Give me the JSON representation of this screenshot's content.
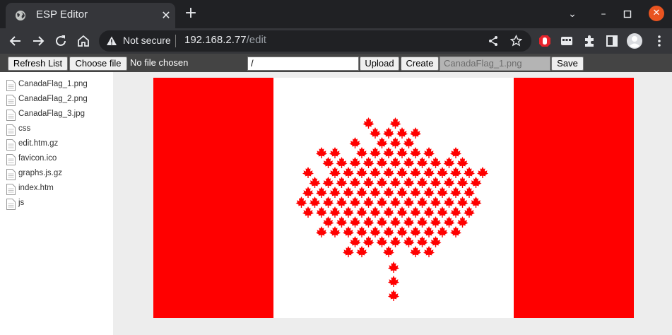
{
  "browser": {
    "tab_title": "ESP Editor",
    "security_label": "Not secure",
    "url_host": "192.168.2.77",
    "url_path": "/edit"
  },
  "editor": {
    "refresh_label": "Refresh List",
    "choose_file_label": "Choose file",
    "no_file_label": "No file chosen",
    "path_value": "/",
    "upload_label": "Upload",
    "create_label": "Create",
    "open_file_value": "CanadaFlag_1.png",
    "save_label": "Save"
  },
  "files": [
    "CanadaFlag_1.png",
    "CanadaFlag_2.png",
    "CanadaFlag_3.jpg",
    "css",
    "edit.htm.gz",
    "favicon.ico",
    "graphs.js.gz",
    "index.htm",
    "js"
  ],
  "colors": {
    "flag_red": "#ff0000",
    "flag_white": "#ffffff",
    "editbar": "#444444",
    "chrome_dark": "#202124",
    "chrome_mid": "#35363a"
  }
}
